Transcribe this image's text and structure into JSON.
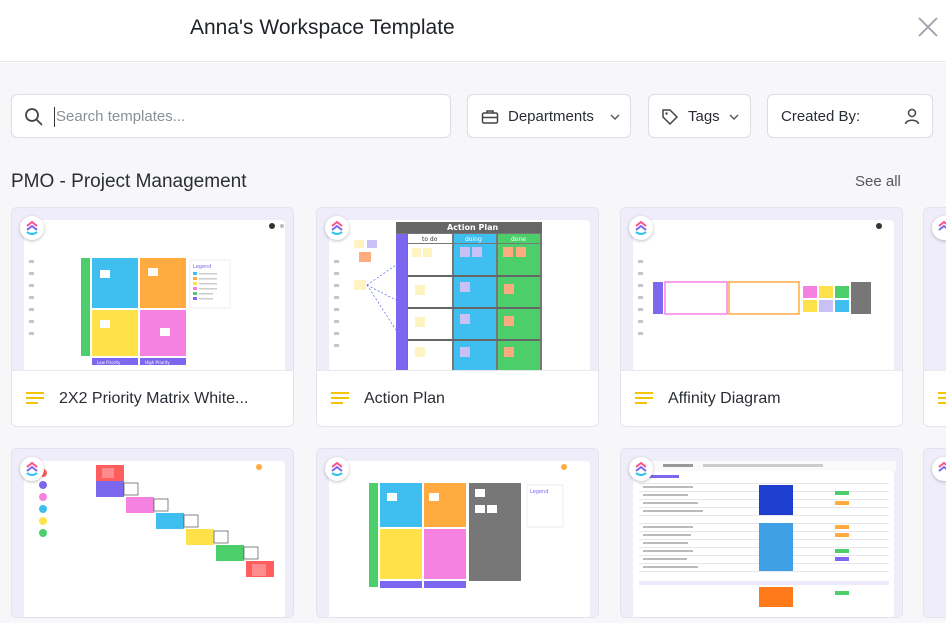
{
  "header": {
    "title": "Anna's Workspace Template"
  },
  "search": {
    "placeholder": "Search templates..."
  },
  "filters": {
    "departments": "Departments",
    "tags": "Tags",
    "created_by": "Created By:"
  },
  "section": {
    "title": "PMO - Project Management",
    "see_all": "See all"
  },
  "cards": [
    {
      "name": "2X2 Priority Matrix White...",
      "icon": "doc-lines-icon"
    },
    {
      "name": "Action Plan",
      "icon": "doc-lines-icon"
    },
    {
      "name": "Affinity Diagram",
      "icon": "doc-lines-icon"
    }
  ],
  "thumb_text": {
    "action_plan_title": "Action Plan",
    "col_todo": "to do",
    "col_doing": "doing",
    "col_done": "done",
    "low_priority": "Low Priority",
    "high_priority": "High Priority",
    "legend": "Legend"
  },
  "colors": {
    "accent": "#7b68ee",
    "doc_icon": "#f5c400",
    "matrix_blue": "#3fbef0",
    "matrix_orange": "#ffab40",
    "matrix_yellow": "#ffe24a",
    "matrix_pink": "#f582e0",
    "matrix_green": "#4ccf6a",
    "matrix_purple": "#7b68ee"
  }
}
